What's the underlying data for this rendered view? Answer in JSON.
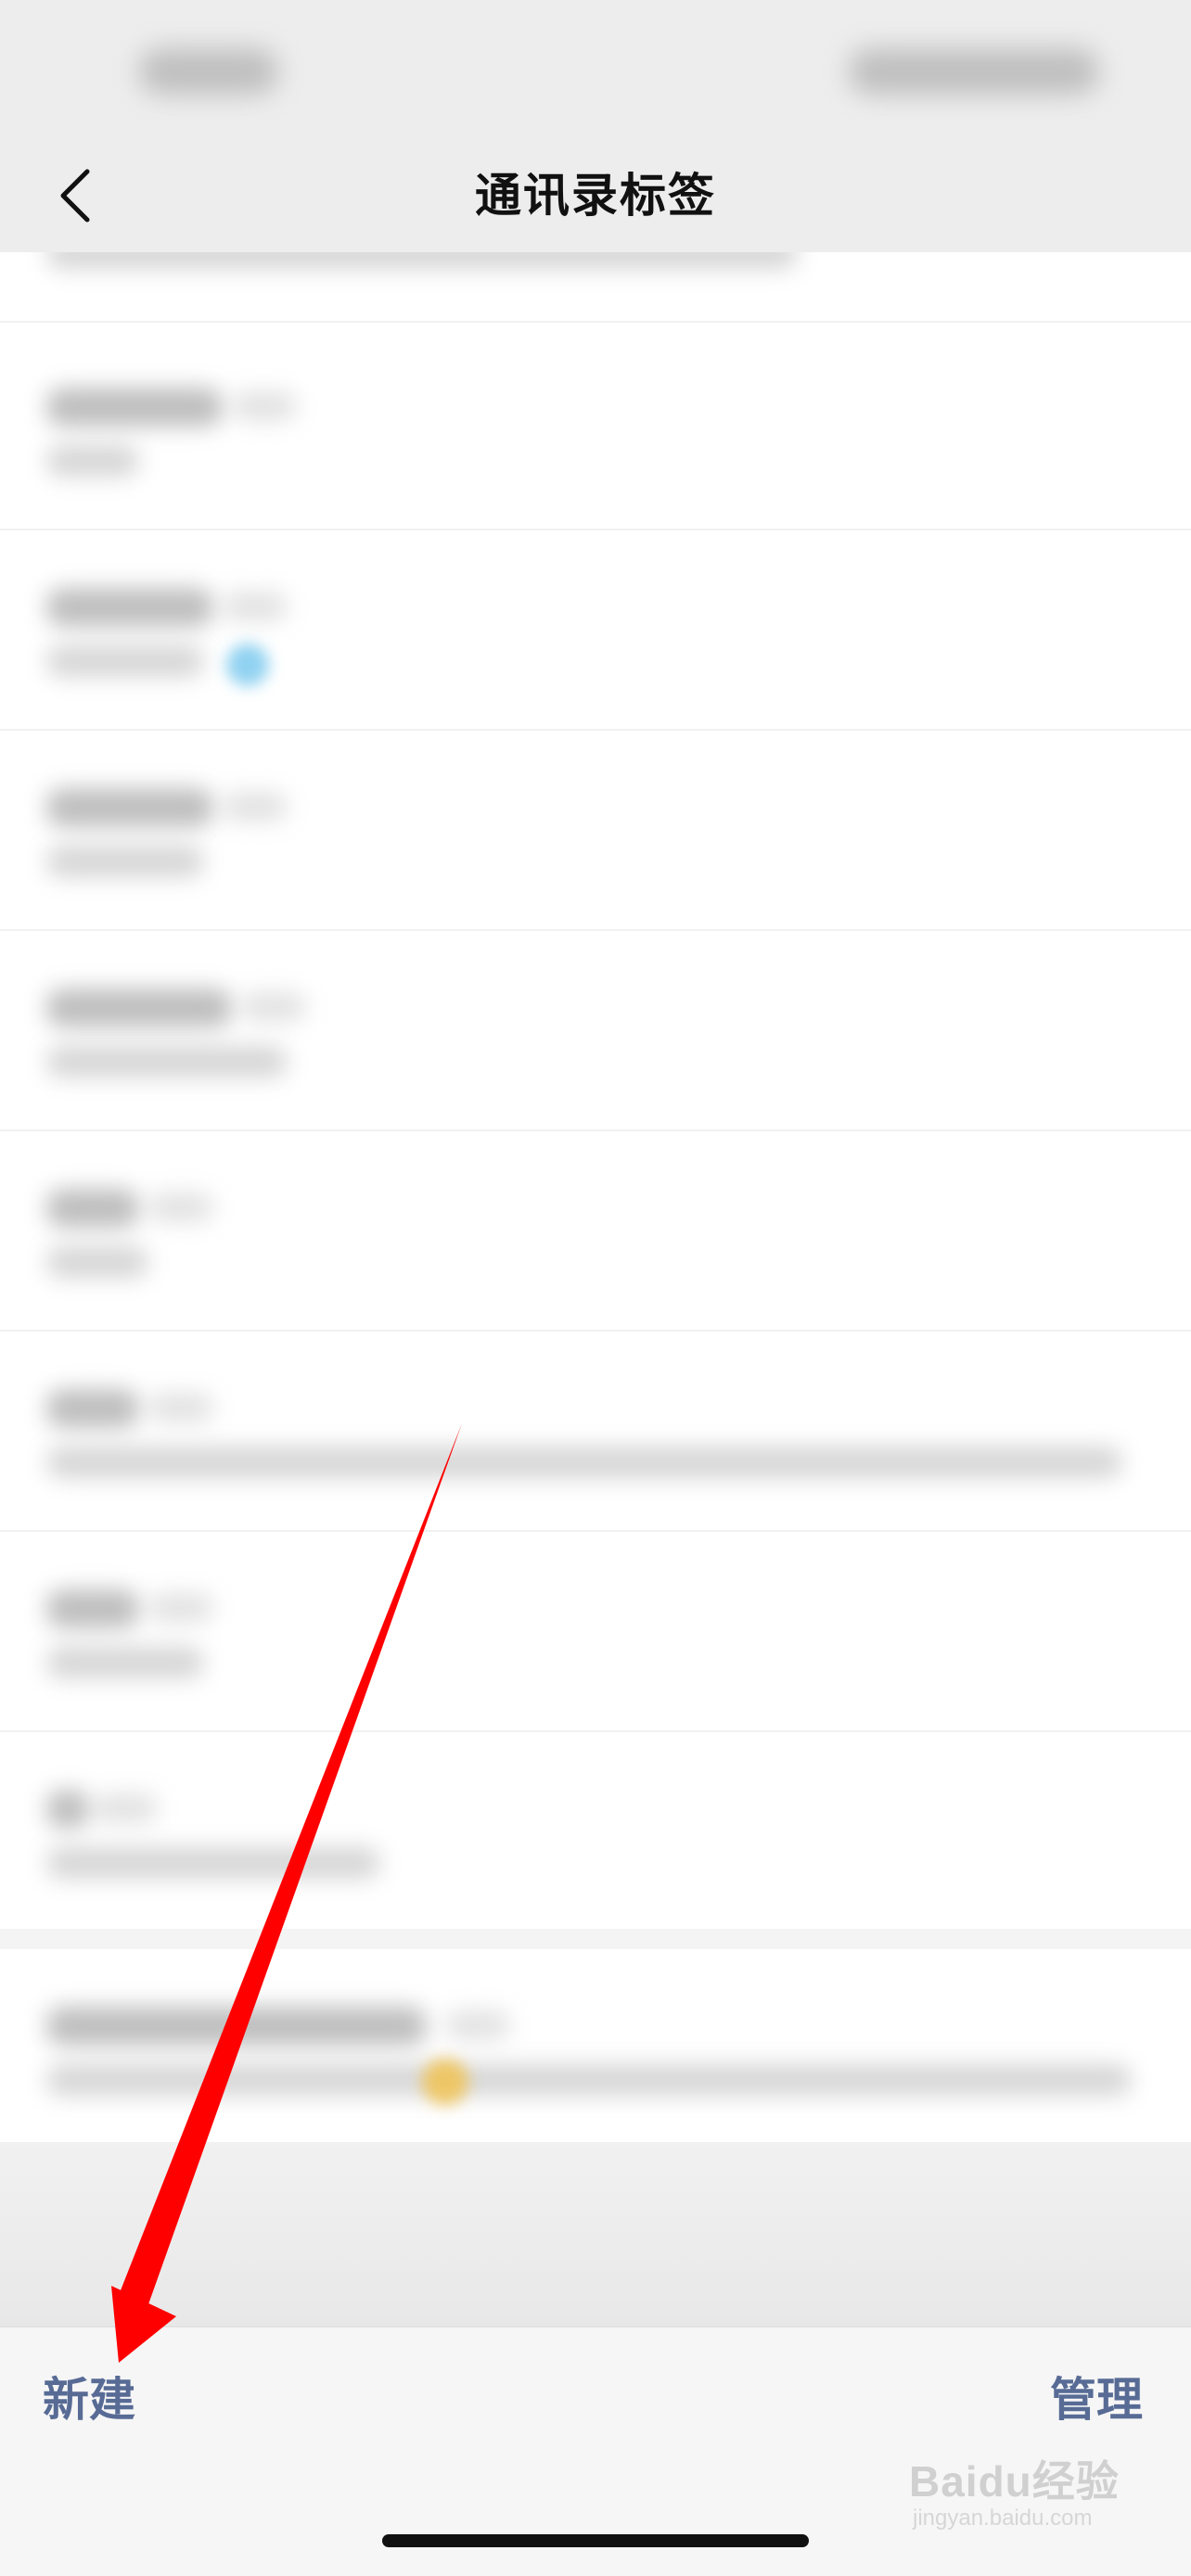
{
  "nav": {
    "title": "通讯录标签",
    "back_icon": "chevron-left-icon"
  },
  "toolbar": {
    "new_label": "新建",
    "manage_label": "管理"
  },
  "colors": {
    "nav_background": "#ededed",
    "toolbar_text": "#576b95",
    "annotation_arrow": "#ff0000"
  },
  "watermark": {
    "main": "Baidu经验",
    "sub": "jingyan.baidu.com"
  }
}
